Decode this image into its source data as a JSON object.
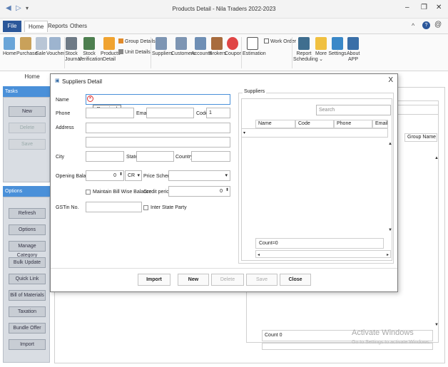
{
  "window": {
    "title": "Products Detail - Nila Traders 2022-2023",
    "minimize": "–",
    "restore": "❐",
    "close": "✕"
  },
  "menu": {
    "file": "File",
    "home": "Home",
    "reports": "Reports",
    "others": "Others"
  },
  "ribbon": {
    "home": "Home",
    "purchase": "Purchase",
    "sale": "Sale",
    "voucher": "Voucher",
    "stock_journal": [
      "Stock",
      "Journal"
    ],
    "stock_verification": [
      "Stock",
      "Verification"
    ],
    "products_detail": [
      "Products",
      "Detail"
    ],
    "group_details": "Group Details",
    "unit_details": "Unit Details",
    "suppliers": "Suppliers",
    "customers": "Customers",
    "accounts": "Accounts",
    "brokers": "Brokers",
    "coupon": "Coupon",
    "estimation": "Estimation",
    "work_order": "Work Order",
    "report_scheduling": [
      "Report",
      "Scheduling"
    ],
    "more": [
      "More",
      "⌄"
    ],
    "settings": "Settings",
    "about_app": [
      "About",
      "APP"
    ],
    "group_label": "Home"
  },
  "left_panel": {
    "tasks_header": "Tasks",
    "options_header": "Options",
    "tasks": [
      {
        "label": "New"
      },
      {
        "label": "Delete"
      },
      {
        "label": "Save"
      }
    ],
    "options": [
      {
        "label": "Refresh"
      },
      {
        "label": "Options"
      },
      {
        "label": "Manage Category"
      },
      {
        "label": "Bulk Update"
      },
      {
        "label": "Quick Link"
      },
      {
        "label": "Bill of Materials"
      },
      {
        "label": "Taxation"
      },
      {
        "label": "Bundle Offer"
      },
      {
        "label": "Import"
      }
    ]
  },
  "background": {
    "group_name_col": "Group Name",
    "count": "Count 0"
  },
  "dialog": {
    "title": "Suppliers Detail",
    "close": "X",
    "labels": {
      "name": "Name",
      "phone": "Phone",
      "email": "Email",
      "code": "Code",
      "address": "Address",
      "city": "City",
      "state": "State",
      "country": "Country",
      "opening_balance": "Opening Balance",
      "price_scheme": "Price Scheme",
      "maintain_bill_wise": "Maintain Bill Wise Balance",
      "credit_period": "Credit period",
      "gstin": "GSTin No.",
      "inter_state": "Inter State Party"
    },
    "values": {
      "code": "1",
      "opening_balance": "0",
      "cr": "CR",
      "credit_period": "0"
    },
    "tooltip": "Required field",
    "suppliers": {
      "header": "Suppliers",
      "search_placeholder": "Search",
      "columns": [
        "Name",
        "Code",
        "Phone",
        "Email"
      ],
      "count": "Count=0"
    },
    "buttons": {
      "import": "Import",
      "new": "New",
      "delete": "Delete",
      "save": "Save",
      "close": "Close"
    }
  },
  "watermark": {
    "line1": "Activate Windows",
    "line2": "Go to Settings to activate Windows."
  },
  "colors": {
    "accent": "#2b579a",
    "panel_header": "#4a90d9",
    "error": "#dd3333"
  }
}
